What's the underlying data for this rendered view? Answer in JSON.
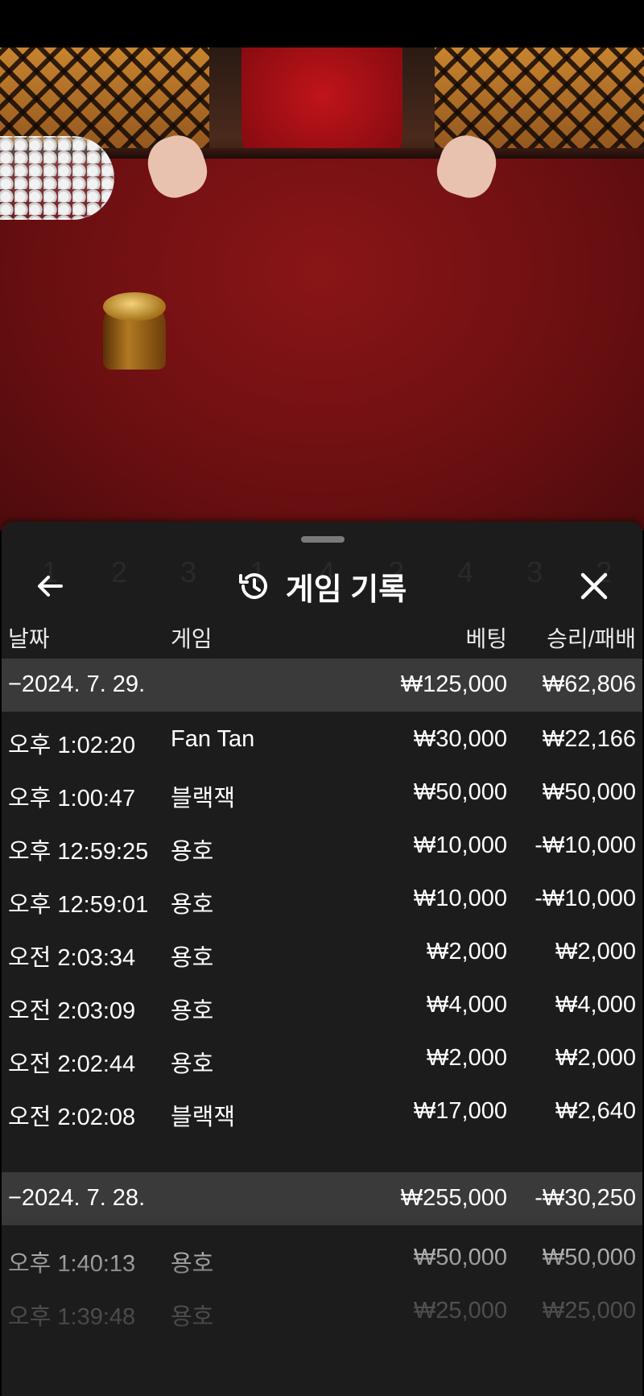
{
  "panel": {
    "title": "게임 기록",
    "back_icon": "arrow-left-icon",
    "history_icon": "history-clock-icon",
    "close_icon": "close-x-icon",
    "columns": {
      "date": "날짜",
      "game": "게임",
      "bet": "베팅",
      "result": "승리/패배"
    }
  },
  "groups": [
    {
      "date": "−2024. 7. 29.",
      "bet_total": "₩125,000",
      "result_total": "₩62,806",
      "rows": [
        {
          "time": "오후 1:02:20",
          "game": "Fan Tan",
          "bet": "₩30,000",
          "result": "₩22,166"
        },
        {
          "time": "오후 1:00:47",
          "game": "블랙잭",
          "bet": "₩50,000",
          "result": "₩50,000"
        },
        {
          "time": "오후 12:59:25",
          "game": "용호",
          "bet": "₩10,000",
          "result": "-₩10,000"
        },
        {
          "time": "오후 12:59:01",
          "game": "용호",
          "bet": "₩10,000",
          "result": "-₩10,000"
        },
        {
          "time": "오전 2:03:34",
          "game": "용호",
          "bet": "₩2,000",
          "result": "₩2,000"
        },
        {
          "time": "오전 2:03:09",
          "game": "용호",
          "bet": "₩4,000",
          "result": "₩4,000"
        },
        {
          "time": "오전 2:02:44",
          "game": "용호",
          "bet": "₩2,000",
          "result": "₩2,000"
        },
        {
          "time": "오전 2:02:08",
          "game": "블랙잭",
          "bet": "₩17,000",
          "result": "₩2,640"
        }
      ]
    },
    {
      "date": "−2024. 7. 28.",
      "bet_total": "₩255,000",
      "result_total": "-₩30,250",
      "rows": [
        {
          "time": "오후 1:40:13",
          "game": "용호",
          "bet": "₩50,000",
          "result": "₩50,000"
        },
        {
          "time": "오후 1:39:48",
          "game": "용호",
          "bet": "₩25,000",
          "result": "₩25,000"
        }
      ]
    }
  ]
}
